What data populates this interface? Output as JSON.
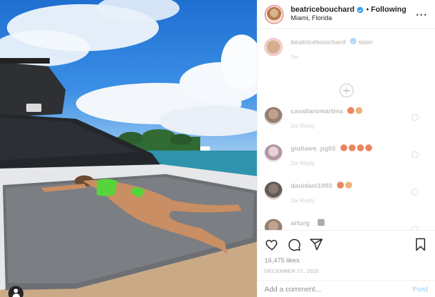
{
  "header": {
    "username": "beatricebouchard",
    "verified": true,
    "separator": "•",
    "follow_state": "Following",
    "location": "Miami, Florida",
    "more_icon": "more-horizontal-icon"
  },
  "caption": {
    "username": "beatricebouchard",
    "text": "soon",
    "meta": "2w"
  },
  "load_more_icon": "plus-circle-icon",
  "comments": [
    {
      "username": "cavallaromartina",
      "meta": "2w   Reply"
    },
    {
      "username": "giuliawe_pg03",
      "meta": "2w   Reply"
    },
    {
      "username": "danidani1993",
      "meta": "2w   Reply"
    },
    {
      "username": "arturg_",
      "meta": ""
    }
  ],
  "actions": {
    "like_icon": "heart-icon",
    "comment_icon": "comment-icon",
    "share_icon": "send-icon",
    "save_icon": "bookmark-icon"
  },
  "likes": "16,475 likes",
  "timestamp": "DECEMBER 27, 2020",
  "add_comment": {
    "placeholder": "Add a comment...",
    "post_label": "Post"
  },
  "colors": {
    "verified": "#3897f0",
    "post_button": "#b3dbff",
    "story_ring": "#e8a0a0"
  }
}
